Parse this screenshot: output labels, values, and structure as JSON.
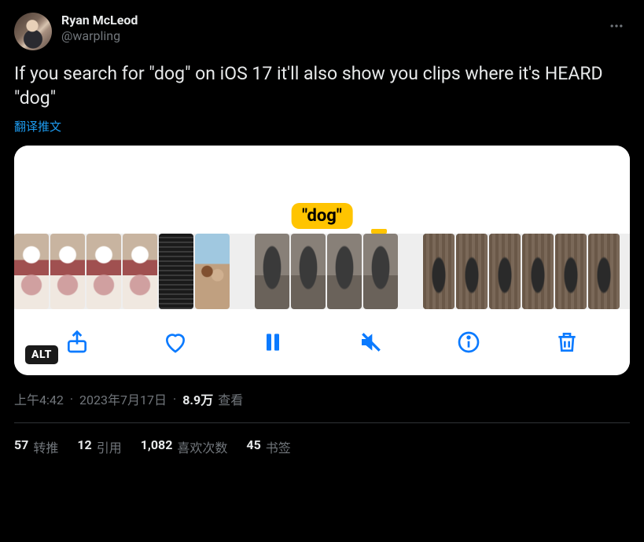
{
  "author": {
    "display_name": "Ryan McLeod",
    "handle": "@warpling"
  },
  "text": "If you search for \"dog\" on iOS 17 it'll also show you clips where it's HEARD \"dog\"",
  "translate_label": "翻译推文",
  "media": {
    "tooltip": "\"dog\"",
    "alt_badge": "ALT"
  },
  "meta": {
    "time": "上午4:42",
    "date": "2023年7月17日",
    "views_count": "8.9万",
    "views_label": "查看"
  },
  "stats": {
    "retweets": {
      "count": "57",
      "label": "转推"
    },
    "quotes": {
      "count": "12",
      "label": "引用"
    },
    "likes": {
      "count": "1,082",
      "label": "喜欢次数"
    },
    "bookmarks": {
      "count": "45",
      "label": "书签"
    }
  }
}
